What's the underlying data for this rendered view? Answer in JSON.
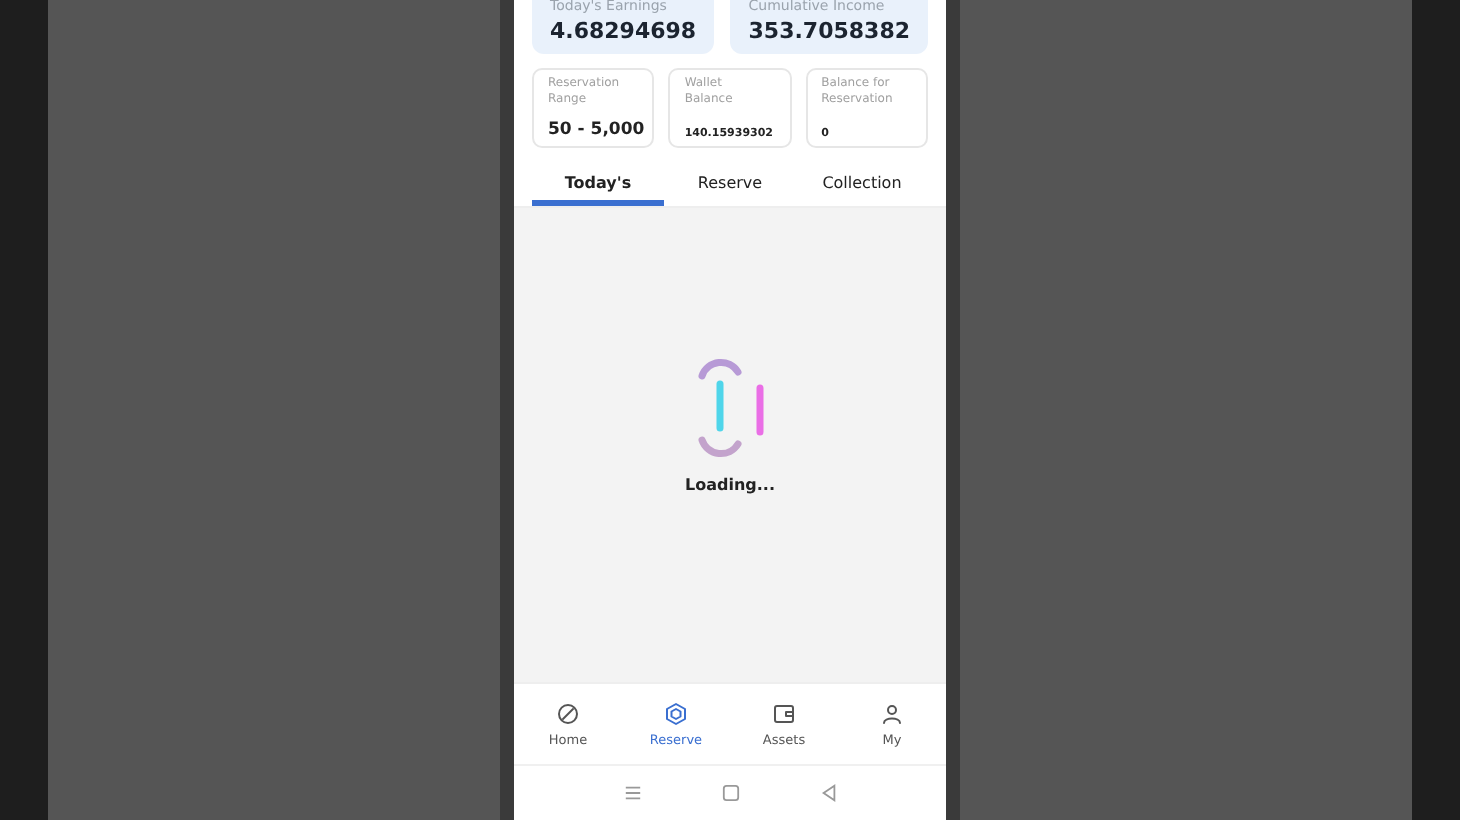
{
  "summary": [
    {
      "label": "Today's Earnings",
      "value": "4.68294698"
    },
    {
      "label": "Cumulative Income",
      "value": "353.7058382"
    }
  ],
  "stats": [
    {
      "label": "Reservation Range",
      "value": "50 - 5,000",
      "kind": "range"
    },
    {
      "label": "Wallet Balance",
      "value": "140.15939302",
      "kind": "amount"
    },
    {
      "label": "Balance for Reservation",
      "value": "0",
      "kind": "amount"
    }
  ],
  "tabs": [
    {
      "label": "Today's",
      "selected": true
    },
    {
      "label": "Reserve",
      "selected": false
    },
    {
      "label": "Collection",
      "selected": false
    }
  ],
  "loading": {
    "text": "Loading..."
  },
  "nav": [
    {
      "kind": "home",
      "label": "Home",
      "selected": false
    },
    {
      "kind": "reserve",
      "label": "Reserve",
      "selected": true
    },
    {
      "kind": "assets",
      "label": "Assets",
      "selected": false
    },
    {
      "kind": "my",
      "label": "My",
      "selected": false
    }
  ]
}
